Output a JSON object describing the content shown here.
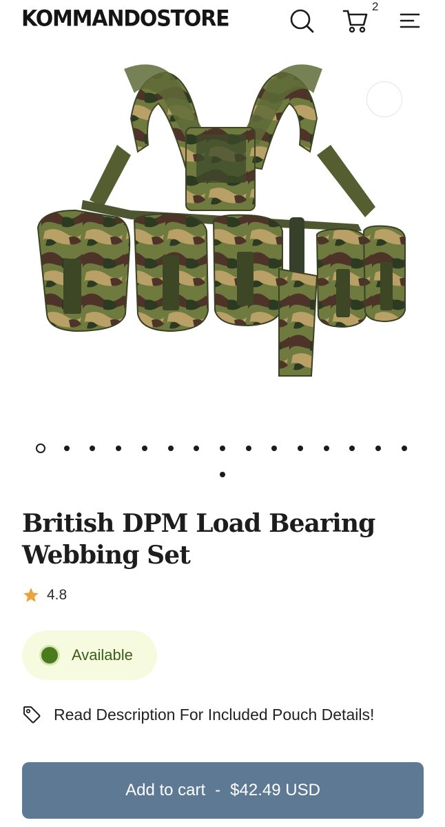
{
  "header": {
    "logo": "KOMMANDOSTORE",
    "cart_count": "2",
    "icons": {
      "search": "search-icon",
      "cart": "cart-icon",
      "menu": "menu-icon"
    }
  },
  "gallery": {
    "image": "british-dpm-webbing-photo",
    "total_images": 16,
    "active_index": 0
  },
  "product": {
    "title": "British DPM Load Bearing Webbing Set",
    "rating": "4.8",
    "availability": "Available",
    "note": "Read Description For Included Pouch Details!",
    "button": {
      "label": "Add to cart",
      "separator": "-",
      "price": "$42.49 USD"
    }
  },
  "colors": {
    "button": "#5d7994",
    "available_dot": "#4a7b1c",
    "available_bg": "#f6fbe0",
    "star": "#e9a53c"
  }
}
